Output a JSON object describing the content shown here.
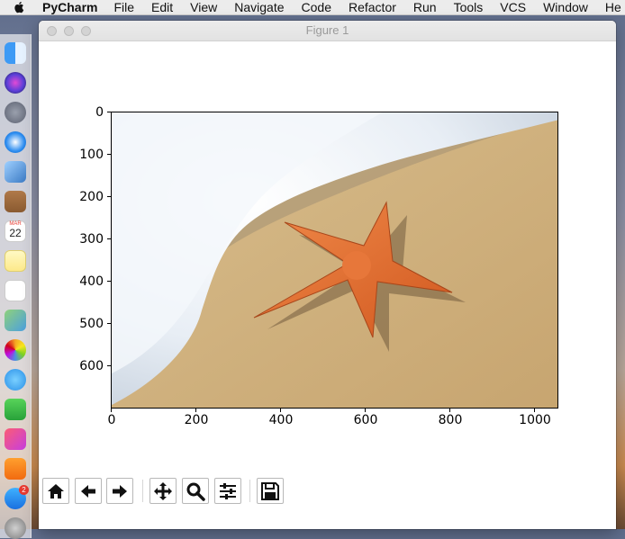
{
  "menubar": {
    "app_name": "PyCharm",
    "items": [
      "File",
      "Edit",
      "View",
      "Navigate",
      "Code",
      "Refactor",
      "Run",
      "Tools",
      "VCS",
      "Window",
      "He"
    ]
  },
  "window": {
    "title": "Figure 1"
  },
  "figure": {
    "image_content": "starfish on sandy beach with sea foam",
    "y_tick_labels": [
      "0",
      "100",
      "200",
      "300",
      "400",
      "500",
      "600"
    ],
    "x_tick_labels": [
      "0",
      "200",
      "400",
      "600",
      "800",
      "1000"
    ]
  },
  "toolbar": {
    "buttons": [
      "home-icon",
      "back-icon",
      "forward-icon",
      "pan-icon",
      "zoom-icon",
      "configure-subplots-icon",
      "save-icon"
    ]
  },
  "dock": {
    "calendar_month": "MAR",
    "calendar_day": "22",
    "appstore_badge": "2"
  }
}
